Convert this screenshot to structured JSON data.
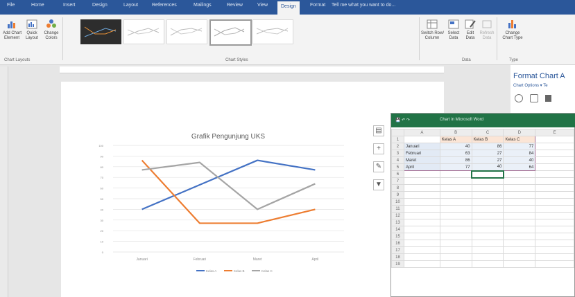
{
  "ribbon_tabs": [
    "File",
    "Home",
    "Insert",
    "Design",
    "Layout",
    "References",
    "Mailings",
    "Review",
    "View",
    "Design",
    "Format"
  ],
  "active_tab_index": 9,
  "tell_me": "Tell me what you want to do...",
  "ribbon": {
    "add_element": "Add Chart\nElement",
    "quick_layout": "Quick\nLayout",
    "change_colors": "Change\nColors",
    "group_layouts": "Chart Layouts",
    "group_styles": "Chart Styles",
    "switch_row_col": "Switch Row/\nColumn",
    "select_data": "Select\nData",
    "edit_data": "Edit\nData",
    "refresh_data": "Refresh\nData",
    "group_data": "Data",
    "change_type": "Change\nChart Type",
    "group_type": "Type"
  },
  "format_pane": {
    "title": "Format Chart A",
    "options": "Chart Options ▾  Te"
  },
  "chart_data": {
    "type": "line",
    "title": "Grafik Pengunjung UKS",
    "categories": [
      "Januari",
      "Februari",
      "Maret",
      "April"
    ],
    "ylim": [
      0,
      100
    ],
    "yticks": [
      0,
      10,
      20,
      30,
      40,
      50,
      60,
      70,
      80,
      90,
      100
    ],
    "series": [
      {
        "name": "Kelas A",
        "color": "#4472c4",
        "values": [
          40,
          63,
          86,
          77
        ]
      },
      {
        "name": "Kelas B",
        "color": "#ed7d31",
        "values": [
          86,
          27,
          27,
          40
        ]
      },
      {
        "name": "Kelas C",
        "color": "#a5a5a5",
        "values": [
          77,
          84,
          40,
          64
        ]
      }
    ],
    "legend": "bottom"
  },
  "excel": {
    "title": "Chart in Microsoft Word",
    "cols": [
      "",
      "A",
      "B",
      "C",
      "D",
      "E"
    ],
    "rows": [
      [
        "1",
        "",
        "Kelas A",
        "Kelas B",
        "Kelas C",
        ""
      ],
      [
        "2",
        "Januari",
        "40",
        "86",
        "77",
        ""
      ],
      [
        "3",
        "Februari",
        "63",
        "27",
        "84",
        ""
      ],
      [
        "4",
        "Maret",
        "86",
        "27",
        "40",
        ""
      ],
      [
        "5",
        "April",
        "77",
        "40",
        "64",
        ""
      ],
      [
        "6",
        "",
        "",
        "",
        "",
        ""
      ],
      [
        "7",
        "",
        "",
        "",
        "",
        ""
      ],
      [
        "8",
        "",
        "",
        "",
        "",
        ""
      ],
      [
        "9",
        "",
        "",
        "",
        "",
        ""
      ],
      [
        "10",
        "",
        "",
        "",
        "",
        ""
      ],
      [
        "11",
        "",
        "",
        "",
        "",
        ""
      ],
      [
        "12",
        "",
        "",
        "",
        "",
        ""
      ],
      [
        "13",
        "",
        "",
        "",
        "",
        ""
      ],
      [
        "14",
        "",
        "",
        "",
        "",
        ""
      ],
      [
        "15",
        "",
        "",
        "",
        "",
        ""
      ],
      [
        "16",
        "",
        "",
        "",
        "",
        ""
      ],
      [
        "17",
        "",
        "",
        "",
        "",
        ""
      ],
      [
        "18",
        "",
        "",
        "",
        "",
        ""
      ],
      [
        "19",
        "",
        "",
        "",
        "",
        ""
      ]
    ]
  },
  "chart_controls": [
    "layout-options",
    "plus",
    "brush",
    "filter"
  ]
}
